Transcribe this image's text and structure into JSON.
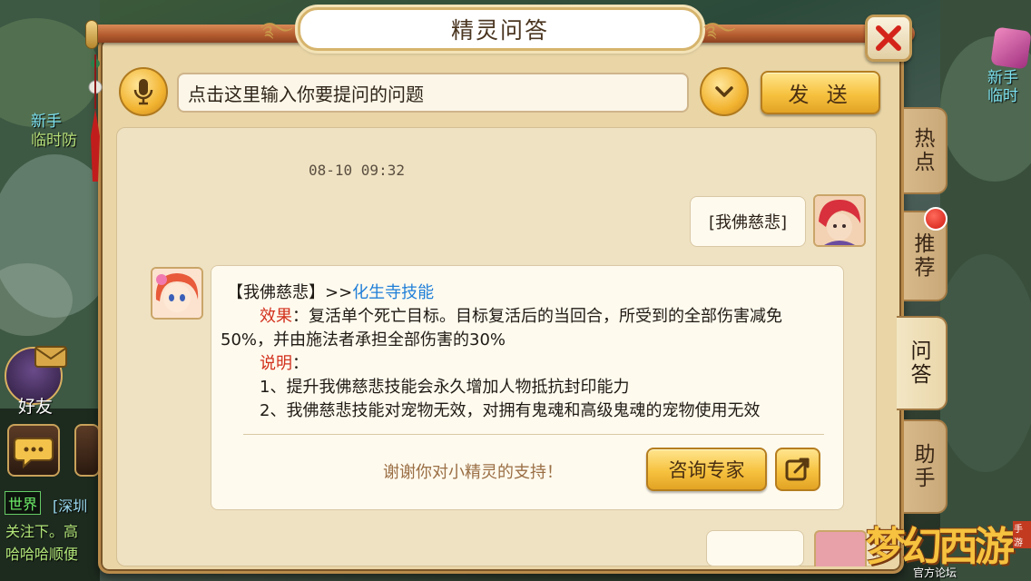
{
  "window": {
    "title": "精灵问答"
  },
  "background": {
    "left_label_1": "新手",
    "left_label_2": "临时防",
    "right_label_1": "新手",
    "right_label_2": "临时",
    "friends_label": "好友",
    "chat_channel": "世界",
    "chat_line_1": "[深圳",
    "chat_line_2": "关注下。高",
    "chat_line_3": "哈哈哈顺便"
  },
  "input": {
    "placeholder": "点击这里输入你要提问的问题",
    "send_label": "发 送"
  },
  "chat": {
    "timestamp": "08-10 09:32",
    "user_message": "[我佛慈悲]",
    "reply": {
      "heading_prefix": "【我佛慈悲】>>",
      "heading_link": "化生寺技能",
      "effect_label": "效果",
      "effect_text_1": "：复活单个死亡目标。目标复活后的当回合，所受到的全部伤害减免",
      "effect_text_2": "50%，并由施法者承担全部伤害的30%",
      "note_label": "说明",
      "note_colon": "：",
      "note_1": "1、提升我佛慈悲技能会永久增加人物抵抗封印能力",
      "note_2": "2、我佛慈悲技能对宠物无效，对拥有鬼魂和高级鬼魂的宠物使用无效"
    },
    "thanks_text": "谢谢你对小精灵的支持！",
    "consult_label": "咨询专家"
  },
  "side_tabs": [
    {
      "label_1": "热",
      "label_2": "点"
    },
    {
      "label_1": "推",
      "label_2": "荐"
    },
    {
      "label_1": "问",
      "label_2": "答"
    },
    {
      "label_1": "助",
      "label_2": "手"
    }
  ],
  "logo": {
    "main": "梦幻西游",
    "sub": "官方论坛",
    "corner": "手游"
  },
  "colors": {
    "accent_gold": "#f6c23f",
    "panel_bg": "#e9d5a6",
    "link_blue": "#1f7fd8",
    "label_red": "#d2301c"
  }
}
